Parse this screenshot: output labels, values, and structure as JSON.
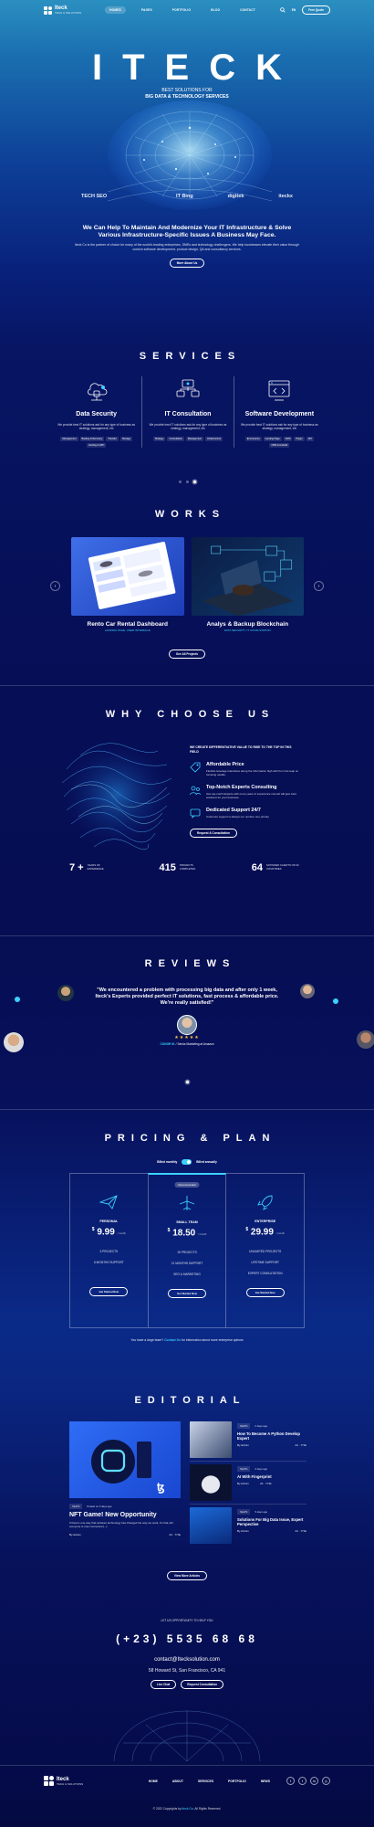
{
  "nav": {
    "logo_name": "Iteck",
    "logo_sub": "TECH & SOLUTIONS",
    "menu": [
      "HOMES",
      "PAGES",
      "PORTFOLIO",
      "BLOG",
      "CONTACT"
    ],
    "lang": "EN",
    "cta": "Free Quote"
  },
  "hero": {
    "title": "ITECK",
    "sub1": "BEST SOLUTIONS FOR",
    "sub2": "BIG DATA & TECHNOLOGY SERVICES",
    "brands": [
      "TECH SEO",
      "",
      "IT Bing",
      "digitek",
      "iteckx"
    ],
    "headline": "We Can Help To Maintain And Modernize Your IT Infrastructure & Solve Various Infrastructure-Specific Issues A Business May Face.",
    "body": "Iteck Co is the partner of choice for many of the world's leading enterprises, SMEs and technology challengers. We help businesses elevate their value through custom software development, product design, QA and consultancy services.",
    "cta": "More About Us"
  },
  "services": {
    "title": "SERVICES",
    "items": [
      {
        "name": "Data Security",
        "desc": "We provide best IT solutions ask for any type of business as strategy, management, etc",
        "tags": [
          "Management",
          "Backup & Recovery",
          "Transfer",
          "Storage",
          "Cooling & HPC"
        ]
      },
      {
        "name": "IT Consultation",
        "desc": "We provide best IT solutions ask for any type of business as strategy, management, etc",
        "tags": [
          "Strategy",
          "Consultation",
          "Management",
          "Infrastructure"
        ]
      },
      {
        "name": "Software Development",
        "desc": "We provide best IT solutions ask for any type of business as strategy, management, etc",
        "tags": [
          "Ecommerce",
          "Landing Page",
          "CMS",
          "Plugin",
          "API",
          "CRM & Android"
        ]
      }
    ]
  },
  "works": {
    "title": "WORKS",
    "items": [
      {
        "name": "Rento Car Rental Dashboard",
        "tags": "LANDING PAGE, USER INTERFACE"
      },
      {
        "name": "Analys & Backup Blockchain",
        "tags": "DATA SECURITY, IT CONSULTATION"
      }
    ],
    "cta": "See All Projects"
  },
  "why": {
    "title": "WHY CHOOSE US",
    "intro": "WE CREATE DIFFERENTIATIVE VALUE TO RISE TO THE TOP IN THIS FIELD",
    "items": [
      {
        "name": "Affordable Price",
        "desc": "Flexible leverage interactive along the information high with from the leap on focusing usable."
      },
      {
        "name": "Top-Notch Experts Consulting",
        "desc": "Use top-notch Experts with more years of experience consult will give best solutions for your business."
      },
      {
        "name": "Dedicated Support 24/7",
        "desc": "Customer support is always our number one priority."
      }
    ],
    "cta": "Request A Consultation",
    "stats": [
      {
        "num": "7 +",
        "label": "YEARS OF EXPERIENCE"
      },
      {
        "num": "415",
        "label": "PROJECTS COMPLETED"
      },
      {
        "num": "64",
        "label": "SATISFIED CLIENTS ON 32 COUNTRIES"
      }
    ]
  },
  "reviews": {
    "title": "REVIEWS",
    "quote": "\"We encountered a problem with processing big data and after only 1 week, Iteck's Experts provided perfect IT solutions, fast process & affordable price. We're really satisfied!\"",
    "stars": "★★★★★",
    "name": "CONOR M.",
    "role": "Senior Marketing at Amazon"
  },
  "pricing": {
    "title": "PRICING & PLAN",
    "toggle_left": "Billed monthly",
    "toggle_right": "Billed annually",
    "badge": "Recommended",
    "plans": [
      {
        "name": "PERSONAL",
        "price": "9.99",
        "per": "/ month",
        "features": [
          "3 PROJECTS",
          "6 MONTHS SUPPORT"
        ],
        "cta": "Get Started Now"
      },
      {
        "name": "SMALL TEAM",
        "price": "18.50",
        "per": "/ month",
        "features": [
          "15 PROJECTS",
          "12 MONTHS SUPPORT",
          "SEO & MARKETING"
        ],
        "cta": "Get Started Now"
      },
      {
        "name": "ENTERPRISE",
        "price": "29.99",
        "per": "/ month",
        "features": [
          "UNLIMITED PROJECTS",
          "LIFETIME SUPPORT",
          "EXPERT CONSULTATION"
        ],
        "cta": "Get Started Now"
      }
    ],
    "note_before": "You have a large team?",
    "note_link": "Contact Us",
    "note_after": "for information about more enterprise options"
  },
  "editorial": {
    "title": "EDITORIAL",
    "feature": {
      "tag": "NEWS",
      "date": "Posted on 3 days ago",
      "title": "NFT Game! New Opportunity",
      "excerpt": "If there's one way that wireless technology has changed the way we work, it's that will everyone is now connected [...]",
      "author": "By Admin",
      "comments": "24",
      "views": "774k"
    },
    "items": [
      {
        "tag": "NEWS",
        "date": "2 days ago",
        "title": "How To Become A Python Develop Expert",
        "author": "By Admin",
        "comments": "24",
        "views": "774k"
      },
      {
        "tag": "NEWS",
        "date": "4 days ago",
        "title": "AI With Fingerprint",
        "author": "By Admin",
        "comments": "24",
        "views": "774k"
      },
      {
        "tag": "NEWS",
        "date": "5 days ago",
        "title": "Solutions For Big Data Issue, Expert Perspective",
        "author": "By Admin",
        "comments": "24",
        "views": "774k"
      }
    ],
    "cta": "View More Articles"
  },
  "contact": {
    "lead": "LET US OPPORTUNITY TO HELP YOU",
    "phone": "(+23) 5535 68 68",
    "email": "contact@Itecksolution.com",
    "address": "58 Howard St, San Francisco, CA 941",
    "btn1": "Live Chat",
    "btn2": "Request Consultation"
  },
  "footer": {
    "menu": [
      "HOME",
      "ABOUT",
      "SERVICES",
      "PORTFOLIO",
      "NEWS"
    ],
    "copy_before": "© 2022 Copyrights by",
    "copy_brand": "Iteck Co.",
    "copy_after": "All Rights Reserved."
  },
  "colors": {
    "accent": "#3ad1ff",
    "bg_dark": "#060b4e",
    "star": "#f7c23c"
  }
}
